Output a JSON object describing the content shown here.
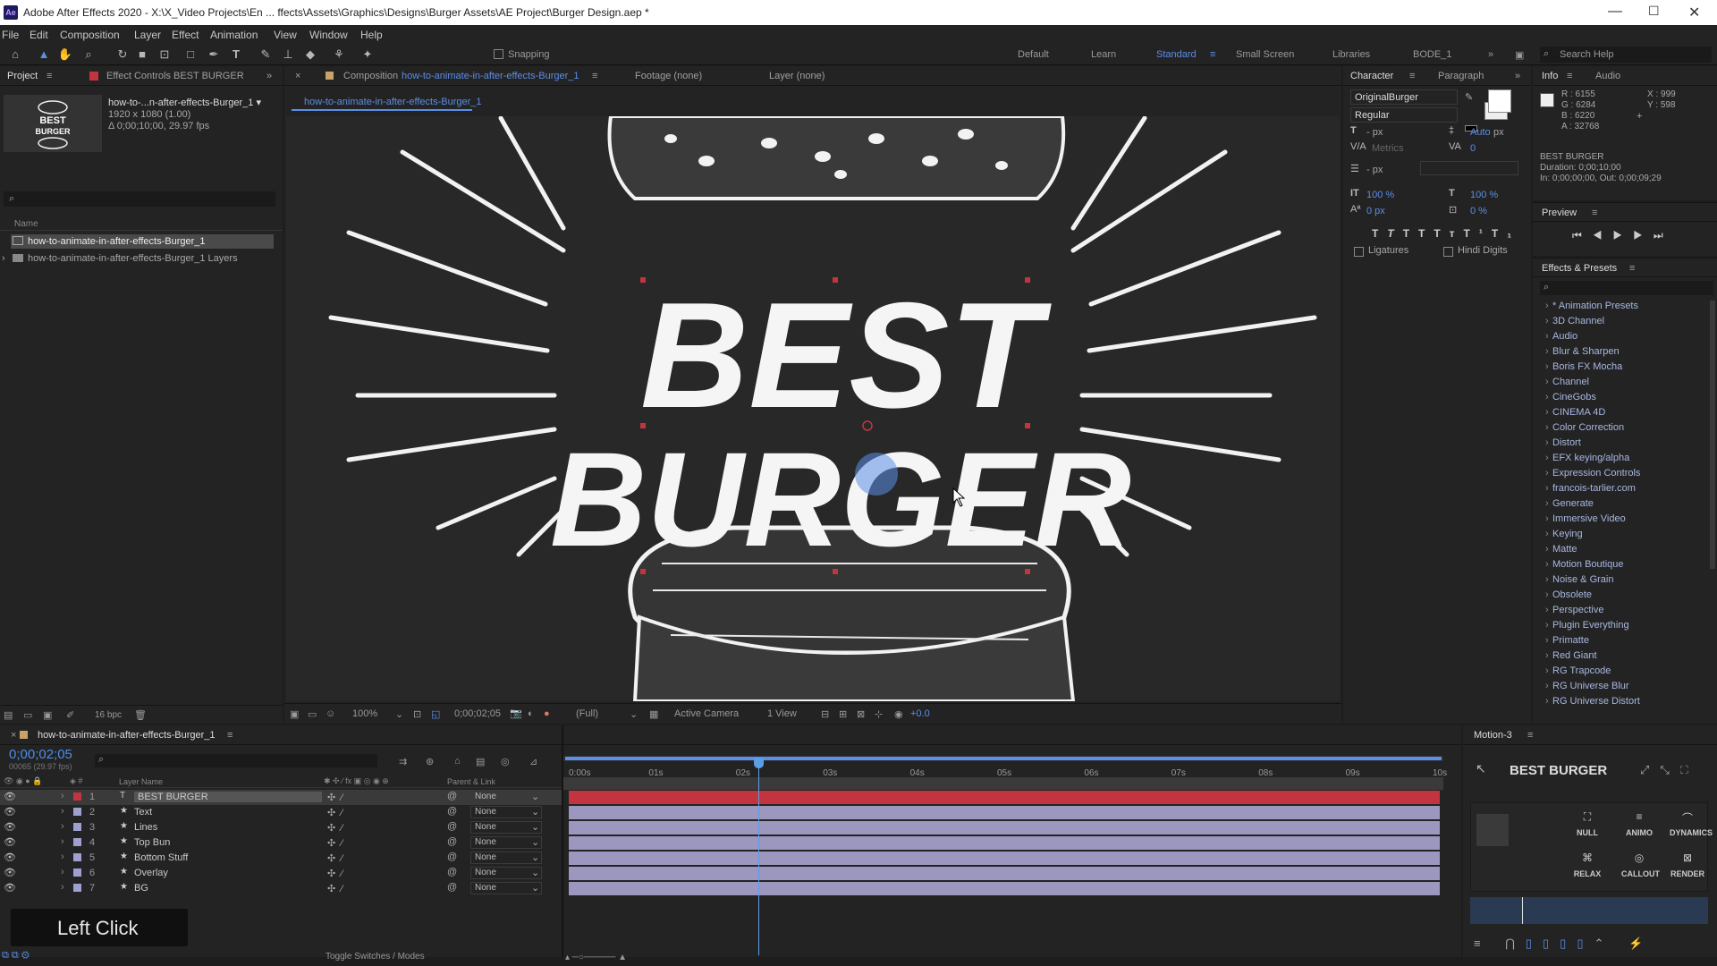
{
  "title_bar": {
    "app_icon": "Ae",
    "title": "Adobe After Effects 2020 - X:\\X_Video Projects\\En ... ffects\\Assets\\Graphics\\Designs\\Burger Assets\\AE Project\\Burger Design.aep *"
  },
  "menu": [
    "File",
    "Edit",
    "Composition",
    "Layer",
    "Effect",
    "Animation",
    "View",
    "Window",
    "Help"
  ],
  "toolbar": {
    "snapping": "Snapping",
    "workspaces": [
      "Default",
      "Learn",
      "Standard",
      "Small Screen",
      "Libraries",
      "BODE_1"
    ],
    "active_workspace": "Standard",
    "search_placeholder": "Search Help"
  },
  "project_panel": {
    "tab": "Project",
    "effect_controls_tab": "Effect Controls BEST BURGER",
    "comp_name": "how-to-...n-after-effects-Burger_1 ▾",
    "comp_res": "1920 x 1080 (1.00)",
    "comp_dur": "Δ 0;00;10;00, 29.97 fps",
    "col_name": "Name",
    "items": [
      "how-to-animate-in-after-effects-Burger_1",
      "how-to-animate-in-after-effects-Burger_1 Layers"
    ],
    "bpc": "16 bpc"
  },
  "comp_panel": {
    "tab_prefix": "Composition",
    "comp_link": "how-to-animate-in-after-effects-Burger_1",
    "footage": "Footage (none)",
    "layer": "Layer (none)",
    "breadcrumb": "how-to-animate-in-after-effects-Burger_1",
    "line1": "BEST",
    "line2": "BURGER",
    "zoom": "100%",
    "timecode": "0;00;02;05",
    "quality": "(Full)",
    "camera": "Active Camera",
    "views": "1 View",
    "exposure": "+0.0"
  },
  "character_panel": {
    "tab": "Character",
    "tab2": "Paragraph",
    "font": "OriginalBurger",
    "style": "Regular",
    "size": "- px",
    "leading": "Auto",
    "leading_unit": "px",
    "kerning": "Metrics",
    "tracking": "0",
    "stroke": "- px",
    "vscale": "100 %",
    "hscale": "100 %",
    "baseline": "0 px",
    "tsume": "0 %",
    "ligatures": "Ligatures",
    "hindi": "Hindi Digits"
  },
  "info_panel": {
    "tab": "Info",
    "tab2": "Audio",
    "r": "R : 6155",
    "g": "G : 6284",
    "b": "B : 6220",
    "a": "A : 32768",
    "x": "X : 999",
    "y": "Y : 598",
    "layer": "BEST BURGER",
    "duration": "Duration: 0;00;10;00",
    "inout": "In: 0;00;00;00, Out: 0;00;09;29"
  },
  "preview_panel": {
    "tab": "Preview"
  },
  "effects_panel": {
    "tab": "Effects & Presets",
    "items": [
      "* Animation Presets",
      "3D Channel",
      "Audio",
      "Blur & Sharpen",
      "Boris FX Mocha",
      "Channel",
      "CineGobs",
      "CINEMA 4D",
      "Color Correction",
      "Distort",
      "EFX keying/alpha",
      "Expression Controls",
      "francois-tarlier.com",
      "Generate",
      "Immersive Video",
      "Keying",
      "Matte",
      "Motion Boutique",
      "Noise & Grain",
      "Obsolete",
      "Perspective",
      "Plugin Everything",
      "Primatte",
      "Red Giant",
      "RG Trapcode",
      "RG Universe Blur",
      "RG Universe Distort"
    ]
  },
  "timeline": {
    "tab": "how-to-animate-in-after-effects-Burger_1",
    "timecode": "0;00;02;05",
    "frames": "00065 (29.97 fps)",
    "col_layer": "Layer Name",
    "col_parent": "Parent & Link",
    "ticks": [
      "0:00s",
      "01s",
      "02s",
      "03s",
      "04s",
      "05s",
      "06s",
      "07s",
      "08s",
      "09s",
      "10s"
    ],
    "layers": [
      {
        "num": "1",
        "name": "BEST BURGER",
        "parent": "None"
      },
      {
        "num": "2",
        "name": "Text",
        "parent": "None"
      },
      {
        "num": "3",
        "name": "Lines",
        "parent": "None"
      },
      {
        "num": "4",
        "name": "Top Bun",
        "parent": "None"
      },
      {
        "num": "5",
        "name": "Bottom Stuff",
        "parent": "None"
      },
      {
        "num": "6",
        "name": "Overlay",
        "parent": "None"
      },
      {
        "num": "7",
        "name": "BG",
        "parent": "None"
      }
    ],
    "toggle": "Toggle Switches / Modes",
    "playhead_fraction": 0.218
  },
  "motion_panel": {
    "tab": "Motion-3",
    "layer": "BEST BURGER",
    "btns": [
      "NULL",
      "ANIMO",
      "DYNAMICS"
    ],
    "btns2": [
      "RELAX",
      "CALLOUT",
      "RENDER"
    ]
  },
  "overlay": {
    "click_label": "Left Click"
  },
  "colors": {
    "accent": "#5b8ee6",
    "timecode": "#4c8ee8",
    "selected_bar": "#c2353f",
    "layer_bar": "#9b97bf",
    "playhead": "#5b9ee8"
  }
}
